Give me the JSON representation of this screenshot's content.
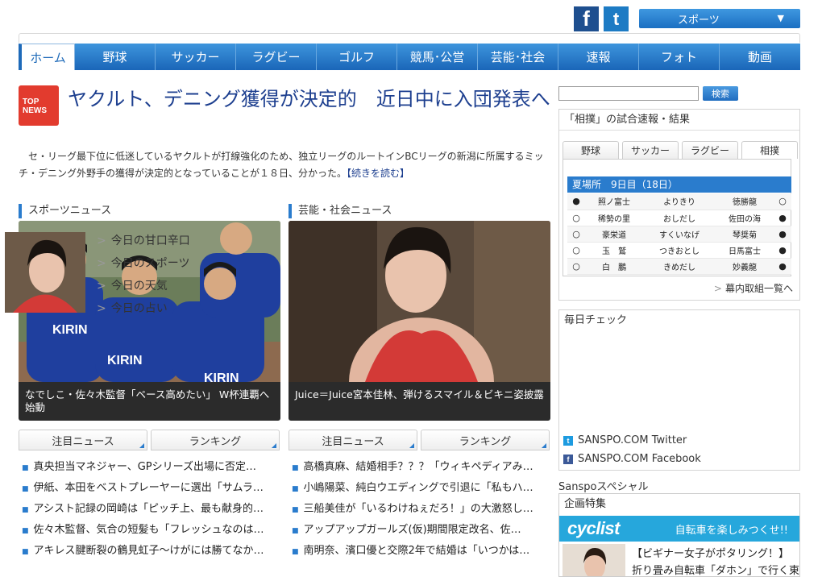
{
  "header": {
    "section_select": "スポーツ",
    "facebook_glyph": "f",
    "twitter_glyph": "t"
  },
  "nav": {
    "items": [
      {
        "label": "ホーム",
        "active": true
      },
      {
        "label": "野球"
      },
      {
        "label": "サッカー"
      },
      {
        "label": "ラグビー"
      },
      {
        "label": "ゴルフ"
      },
      {
        "label": "競馬･公営"
      },
      {
        "label": "芸能･社会"
      },
      {
        "label": "速報"
      },
      {
        "label": "フォト"
      },
      {
        "label": "動画"
      }
    ]
  },
  "top_news": {
    "badge_line1": "TOP",
    "badge_line2": "NEWS",
    "headline": "ヤクルト、デニング獲得が決定的　近日中に入団発表へ",
    "lede": "　セ・リーグ最下位に低迷しているヤクルトが打線強化のため、独立リーグのルートインBCリーグの新潟に所属するミッチ・デニング外野手の獲得が決定的となっていることが１８日、分かった。",
    "more": "【続きを読む】"
  },
  "sports_news": {
    "heading": "スポーツニュース",
    "caption": "なでしこ・佐々木監督「ベース高めたい」 W杯連覇へ始動",
    "tabs": [
      "注目ニュース",
      "ランキング"
    ],
    "items": [
      "真央担当マネジャー、GPシリーズ出場に否定…",
      "伊紙、本田をベストプレーヤーに選出「サムラ…",
      "アシスト記録の岡崎は「ピッチ上、最も献身的…",
      "佐々木監督、気合の短髪も「フレッシュなのは…",
      "アキレス腱断裂の鶴見虹子～けがには勝てなか…"
    ]
  },
  "ent_news": {
    "heading": "芸能・社会ニュース",
    "caption": "Juice＝Juice宮本佳林、弾けるスマイル＆ビキニ姿披露",
    "tabs": [
      "注目ニュース",
      "ランキング"
    ],
    "items": [
      "高橋真麻、結婚相手？？？「ウィキペディアみ…",
      "小嶋陽菜、純白ウエディングで引退に「私もハ…",
      "三船美佳が「いるわけねぇだろ！」の大激怒し…",
      "アップアップガールズ(仮)期間限定改名、佐…",
      "南明奈、濱口優と交際2年で結婚は「いつかは…"
    ]
  },
  "search": {
    "placeholder": "",
    "button": "検索"
  },
  "sumo": {
    "title": "「相撲」の試合速報・結果",
    "tabs": [
      "野球",
      "サッカー",
      "ラグビー",
      "相撲"
    ],
    "active_tab": 3,
    "basho": "夏場所　9日目（18日）",
    "bouts": [
      {
        "east_result": "●",
        "east": "照ノ富士",
        "kimarite": "よりきり",
        "west": "徳勝龍",
        "west_result": "○"
      },
      {
        "east_result": "○",
        "east": "稀勢の里",
        "kimarite": "おしだし",
        "west": "佐田の海",
        "west_result": "●"
      },
      {
        "east_result": "○",
        "east": "豪栄道",
        "kimarite": "すくいなげ",
        "west": "琴奨菊",
        "west_result": "●"
      },
      {
        "east_result": "○",
        "east": "玉　鷲",
        "kimarite": "つきおとし",
        "west": "日馬富士",
        "west_result": "●"
      },
      {
        "east_result": "○",
        "east": "白　鵬",
        "kimarite": "きめだし",
        "west": "妙義龍",
        "west_result": "●"
      }
    ],
    "more": "幕内取組一覧へ"
  },
  "daily": {
    "title": "毎日チェック",
    "links": [
      "今日の甘口辛口",
      "今日のスポーツ",
      "今日の天気",
      "今日の占い"
    ],
    "twitter": "SANSPO.COM Twitter",
    "facebook": "SANSPO.COM Facebook"
  },
  "special": {
    "heading": "Sanspoスペシャル",
    "kikaku_title": "企画特集",
    "banner_logo": "cyclist",
    "banner_tag": "自転車を楽しみつくせ!!",
    "feature_line1": "【ビギナー女子がポタリング！】",
    "feature_line2": "折り畳み自転車「ダホン」で行く東"
  },
  "colors": {
    "brand_blue": "#1e6ab9",
    "headline_navy": "#1d3f8f",
    "top_news_red": "#e23b2e",
    "cyclist_cyan": "#26a7dc"
  }
}
